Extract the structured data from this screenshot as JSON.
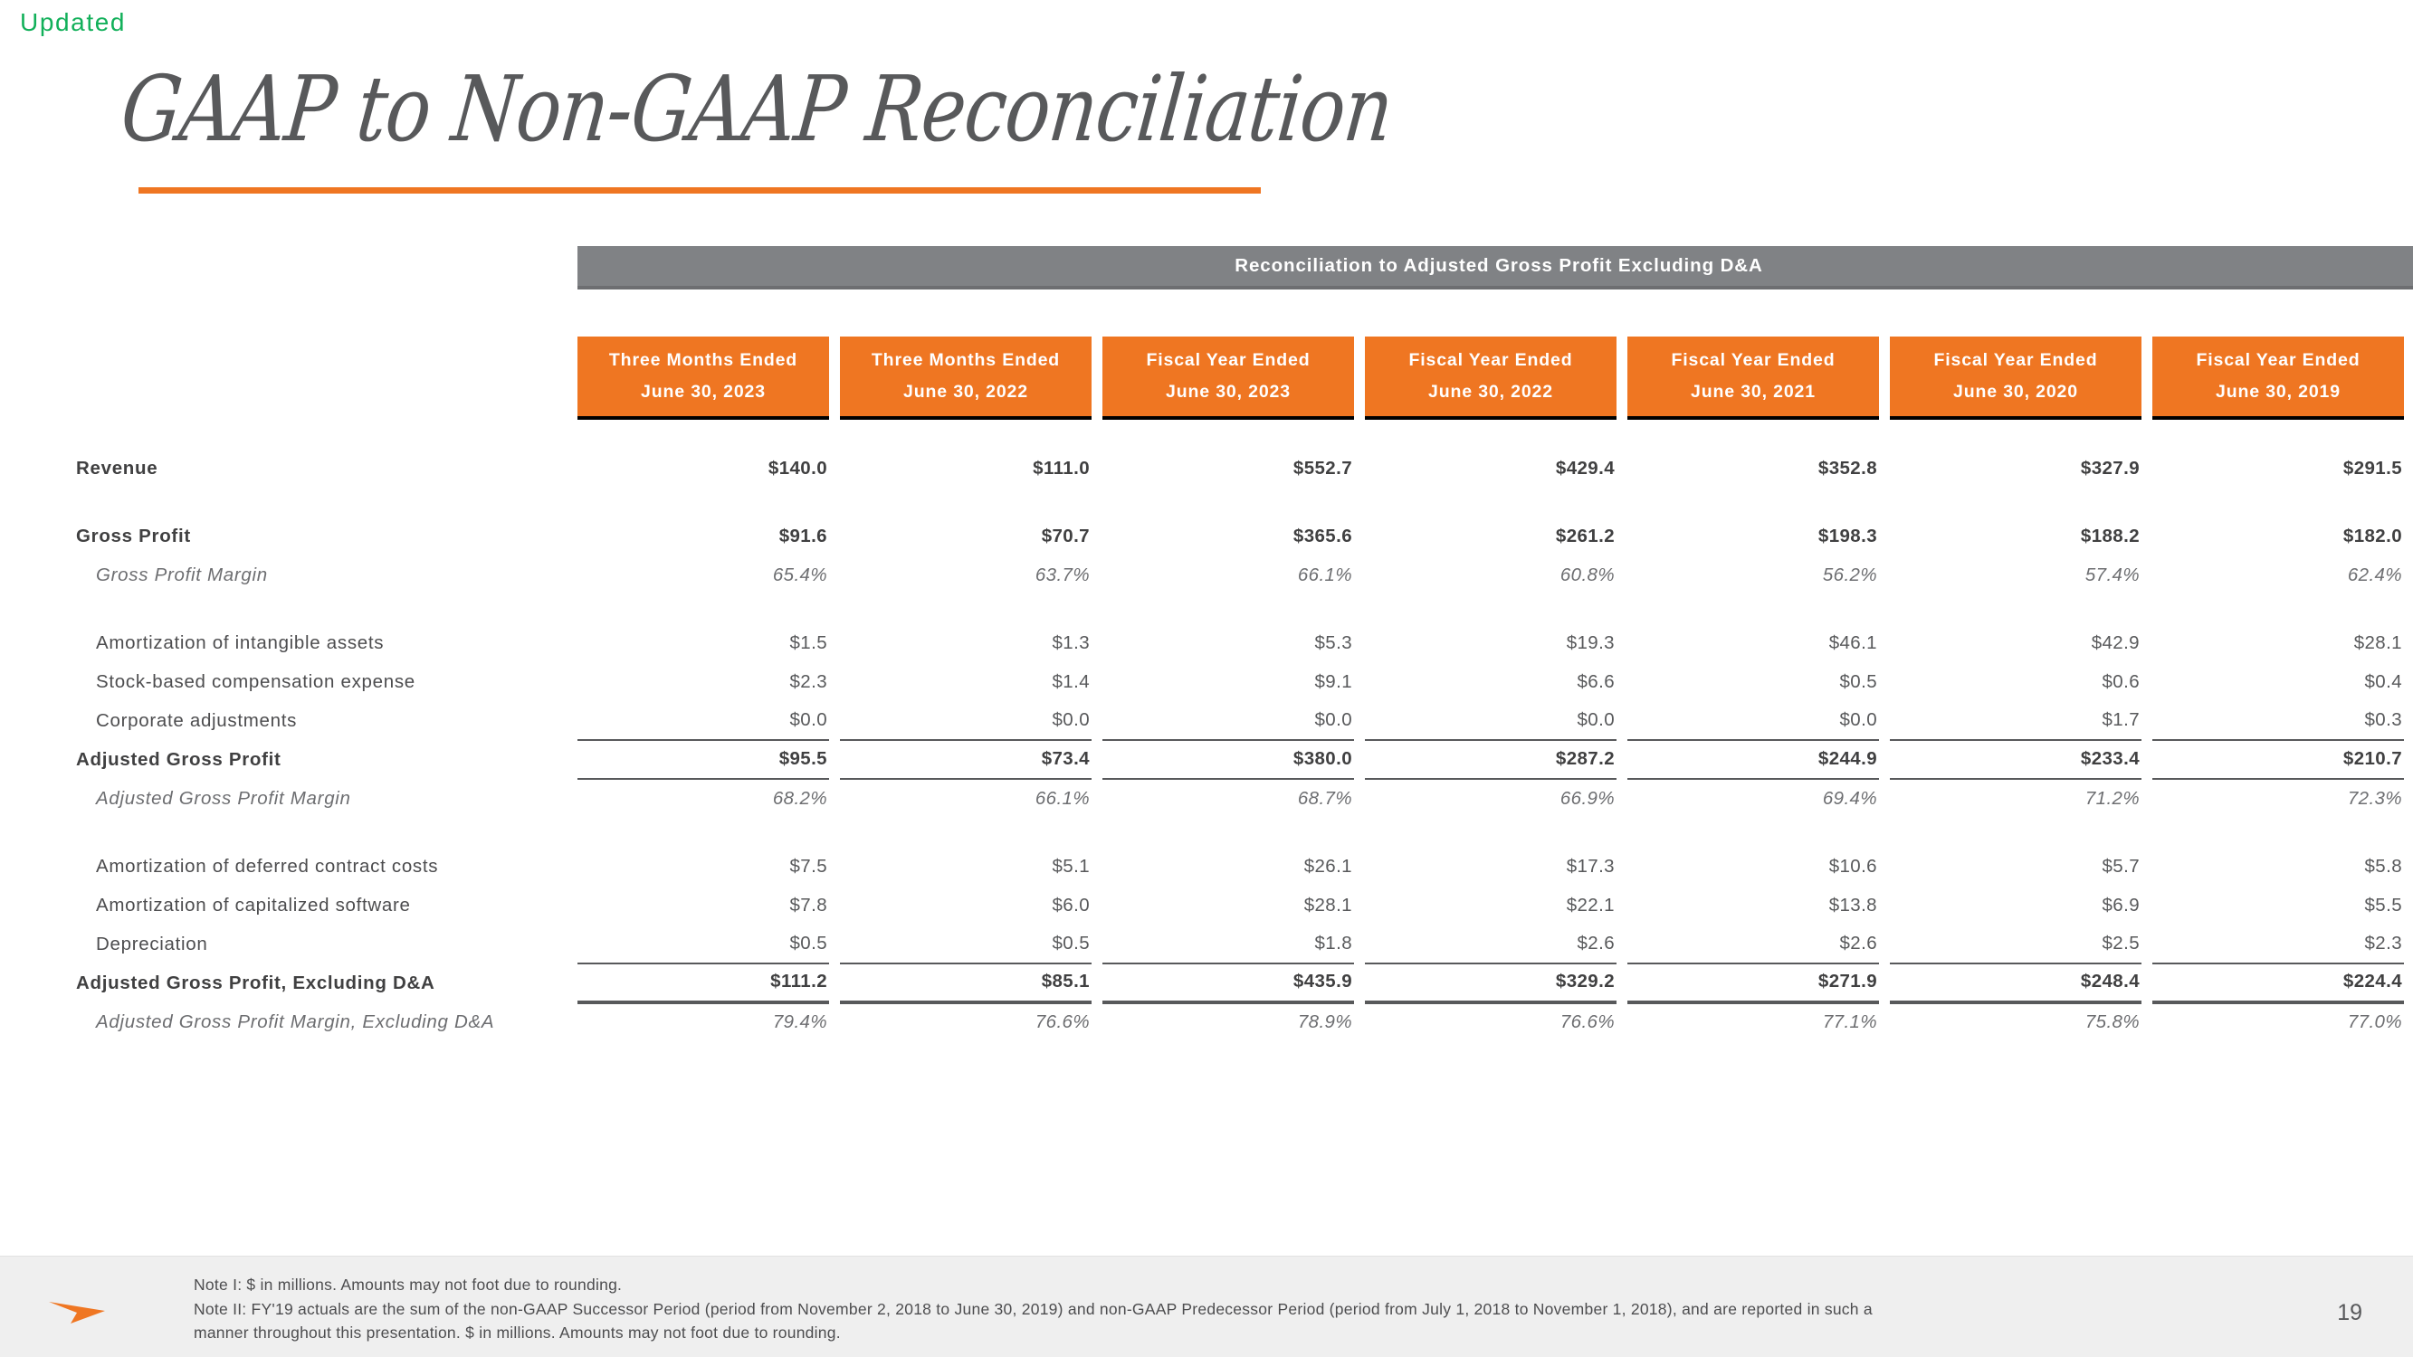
{
  "badge": {
    "label": "Updated",
    "color": "#12b05a"
  },
  "title": {
    "text": "GAAP to Non-GAAP Reconciliation",
    "underline_color": "#ef7622"
  },
  "table": {
    "banner": "Reconciliation to Adjusted Gross Profit Excluding D&A",
    "banner_bg": "#808285",
    "header_bg": "#ef7622",
    "columns": [
      {
        "period": "Three Months Ended",
        "date": "June 30, 2023"
      },
      {
        "period": "Three Months Ended",
        "date": "June 30, 2022"
      },
      {
        "period": "Fiscal Year Ended",
        "date": "June 30, 2023"
      },
      {
        "period": "Fiscal Year Ended",
        "date": "June 30, 2022"
      },
      {
        "period": "Fiscal Year Ended",
        "date": "June 30, 2021"
      },
      {
        "period": "Fiscal Year Ended",
        "date": "June 30, 2020"
      },
      {
        "period": "Fiscal Year Ended",
        "date": "June 30, 2019"
      }
    ],
    "rows": [
      {
        "label": "Revenue",
        "values": [
          "$140.0",
          "$111.0",
          "$552.7",
          "$429.4",
          "$352.8",
          "$327.9",
          "$291.5"
        ]
      },
      {
        "label": "Gross Profit",
        "values": [
          "$91.6",
          "$70.7",
          "$365.6",
          "$261.2",
          "$198.3",
          "$188.2",
          "$182.0"
        ]
      },
      {
        "label": "Gross Profit Margin",
        "values": [
          "65.4%",
          "63.7%",
          "66.1%",
          "60.8%",
          "56.2%",
          "57.4%",
          "62.4%"
        ]
      },
      {
        "label": "Amortization of intangible assets",
        "values": [
          "$1.5",
          "$1.3",
          "$5.3",
          "$19.3",
          "$46.1",
          "$42.9",
          "$28.1"
        ]
      },
      {
        "label": "Stock-based compensation expense",
        "values": [
          "$2.3",
          "$1.4",
          "$9.1",
          "$6.6",
          "$0.5",
          "$0.6",
          "$0.4"
        ]
      },
      {
        "label": "Corporate adjustments",
        "values": [
          "$0.0",
          "$0.0",
          "$0.0",
          "$0.0",
          "$0.0",
          "$1.7",
          "$0.3"
        ]
      },
      {
        "label": "Adjusted Gross Profit",
        "values": [
          "$95.5",
          "$73.4",
          "$380.0",
          "$287.2",
          "$244.9",
          "$233.4",
          "$210.7"
        ]
      },
      {
        "label": "Adjusted Gross Profit Margin",
        "values": [
          "68.2%",
          "66.1%",
          "68.7%",
          "66.9%",
          "69.4%",
          "71.2%",
          "72.3%"
        ]
      },
      {
        "label": "Amortization of deferred contract costs",
        "values": [
          "$7.5",
          "$5.1",
          "$26.1",
          "$17.3",
          "$10.6",
          "$5.7",
          "$5.8"
        ]
      },
      {
        "label": "Amortization of capitalized software",
        "values": [
          "$7.8",
          "$6.0",
          "$28.1",
          "$22.1",
          "$13.8",
          "$6.9",
          "$5.5"
        ]
      },
      {
        "label": "Depreciation",
        "values": [
          "$0.5",
          "$0.5",
          "$1.8",
          "$2.6",
          "$2.6",
          "$2.5",
          "$2.3"
        ]
      },
      {
        "label": "Adjusted Gross Profit, Excluding D&A",
        "values": [
          "$111.2",
          "$85.1",
          "$435.9",
          "$329.2",
          "$271.9",
          "$248.4",
          "$224.4"
        ]
      },
      {
        "label": "Adjusted Gross Profit Margin, Excluding D&A",
        "values": [
          "79.4%",
          "76.6%",
          "78.9%",
          "76.6%",
          "77.1%",
          "75.8%",
          "77.0%"
        ]
      }
    ]
  },
  "footer": {
    "note1": "Note I: $ in millions. Amounts may not foot due to rounding.",
    "note2_line1": "Note II: FY'19 actuals are the sum of the non-GAAP Successor Period (period from November 2, 2018 to June 30, 2019) and non-GAAP Predecessor Period (period from July 1, 2018 to November 1, 2018), and are reported in such a",
    "note2_line2": "manner throughout this presentation. $ in millions. Amounts may not foot due to rounding.",
    "page_number": "19",
    "logo_color": "#ef7622"
  }
}
